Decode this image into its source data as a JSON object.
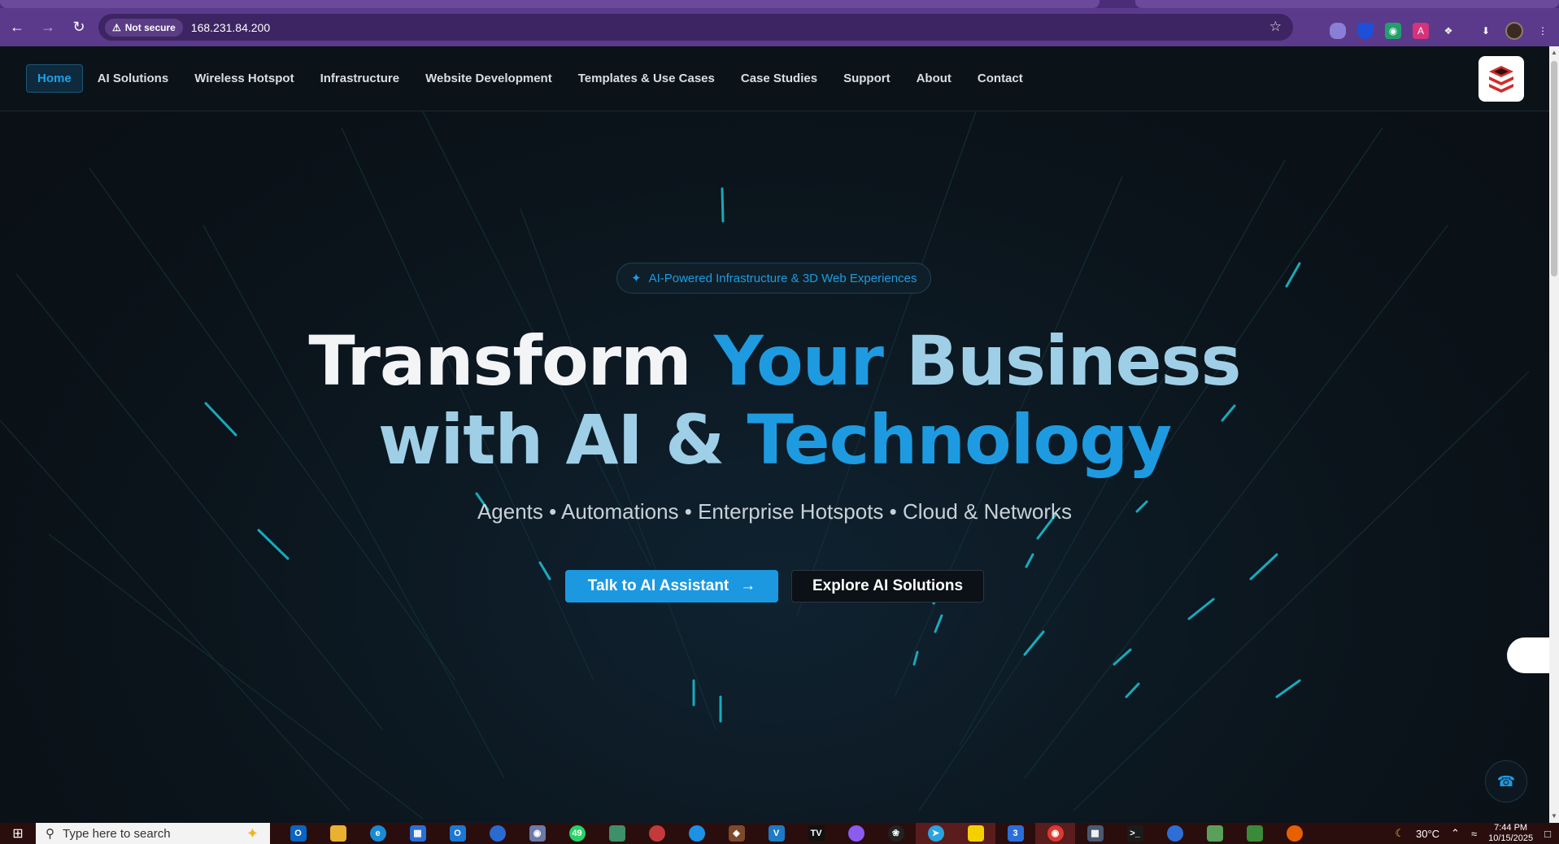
{
  "browser": {
    "security_label": "Not secure",
    "url": "168.231.84.200",
    "icons": [
      "back-icon",
      "forward-icon",
      "reload-icon",
      "warning-icon",
      "star-icon",
      "extensions-icon",
      "download-icon",
      "menu-icon"
    ]
  },
  "site": {
    "nav": [
      {
        "label": "Home",
        "active": true
      },
      {
        "label": "AI Solutions"
      },
      {
        "label": "Wireless Hotspot"
      },
      {
        "label": "Infrastructure"
      },
      {
        "label": "Website Development"
      },
      {
        "label": "Templates & Use Cases"
      },
      {
        "label": "Case Studies"
      },
      {
        "label": "Support"
      },
      {
        "label": "About"
      },
      {
        "label": "Contact"
      }
    ],
    "colors": {
      "accent": "#1e9be0",
      "background": "#0b141b",
      "logo_red": "#d42a2a"
    }
  },
  "hero": {
    "badge": "AI-Powered Infrastructure & 3D Web Experiences",
    "headline_line1": [
      "Transform",
      "Your",
      "Business"
    ],
    "headline_line2": [
      "with",
      "AI",
      "&",
      "Technology"
    ],
    "subtitle": "Agents • Automations • Enterprise Hotspots • Cloud & Networks",
    "primary_button": "Talk to AI Assistant",
    "secondary_button": "Explore AI Solutions"
  },
  "taskbar": {
    "search_placeholder": "Type here to search",
    "badges": {
      "whatsapp": "49",
      "word": "3"
    },
    "weather": "30°C",
    "time": "7:44 PM",
    "date": "10/15/2025"
  }
}
